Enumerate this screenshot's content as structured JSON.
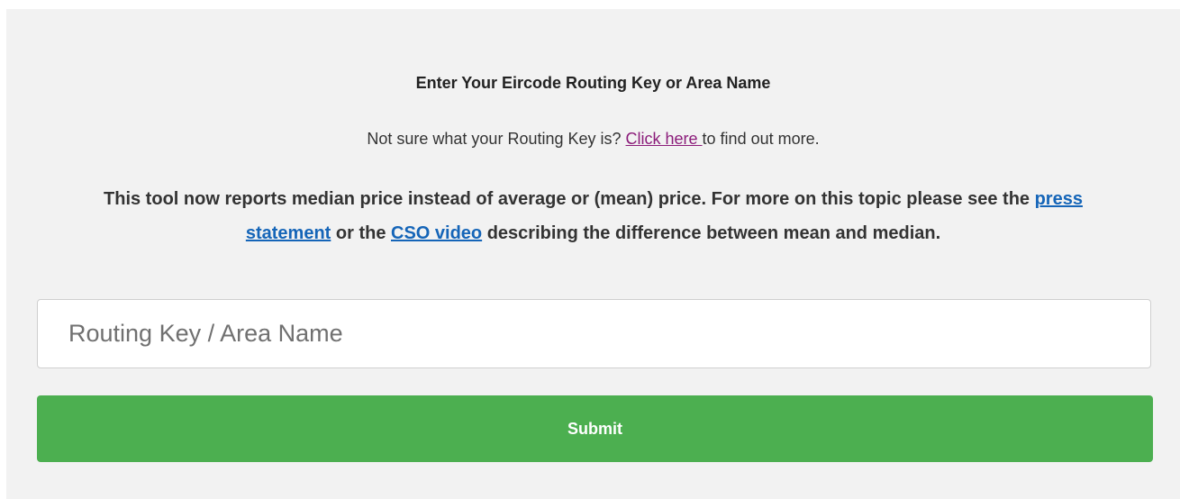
{
  "form": {
    "heading": "Enter Your Eircode Routing Key or Area Name",
    "helper": {
      "prefix": "Not sure what your Routing Key is? ",
      "link_label": "Click here ",
      "suffix": "to find out more."
    },
    "notice": {
      "part1": "This tool now reports median price instead of average or (mean) price. For more on this topic please see the ",
      "press_link": "press statement",
      "part2": " or the ",
      "video_link": "CSO video",
      "part3": " describing the difference between mean and median."
    },
    "search": {
      "placeholder": "Routing Key / Area Name",
      "value": ""
    },
    "submit_label": "Submit"
  },
  "colors": {
    "panel_background": "#f2f2f2",
    "submit_background": "#4caf50",
    "visited_link": "#8b1c7a",
    "link": "#1565b8"
  }
}
